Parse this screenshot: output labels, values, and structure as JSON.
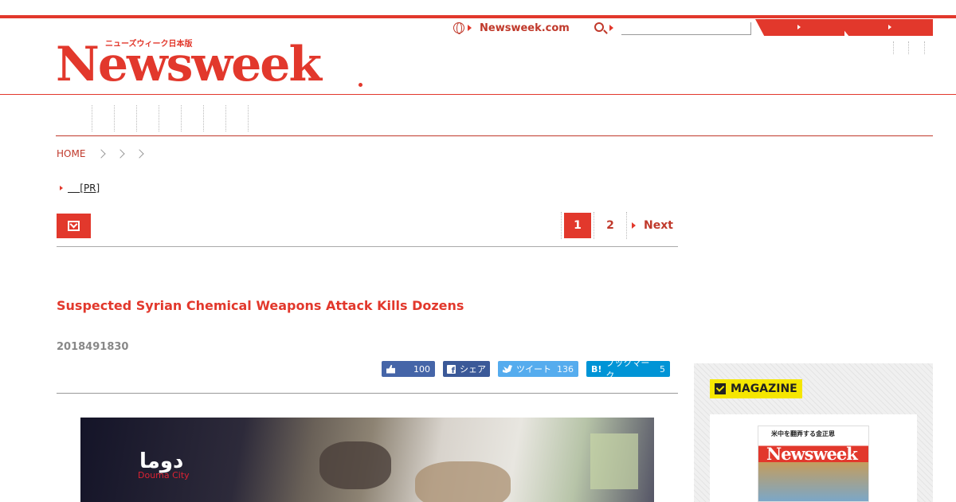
{
  "header": {
    "logo_text": "Newsweek",
    "logo_subtext": "ニューズウィーク日本版",
    "site_link": "Newsweek.com"
  },
  "breadcrumb": {
    "home": "HOME"
  },
  "pr_link": "[PR]",
  "pagination": {
    "current": "1",
    "page2": "2",
    "next": "Next"
  },
  "article": {
    "headline": "Suspected Syrian Chemical Weapons Attack Kills Dozens",
    "date": "2018491830"
  },
  "social": {
    "like_count": "100",
    "share_label": "シェア",
    "tweet_label": "ツイート",
    "tweet_count": "136",
    "bookmark_icon": "B!",
    "bookmark_label": "ブックマーク",
    "bookmark_count": "5"
  },
  "video": {
    "overlay_arabic": "دوما",
    "overlay_english": "Douma City"
  },
  "sidebar": {
    "magazine_label": "MAGAZINE",
    "cover_kicker": "米中を翻弄する金正恩",
    "cover_logo": "Newsweek"
  },
  "colors": {
    "brand": "#e2382c",
    "facebook": "#4565a8",
    "twitter": "#55acee",
    "hatena": "#0094d6",
    "magazine_label": "#f5e600"
  }
}
